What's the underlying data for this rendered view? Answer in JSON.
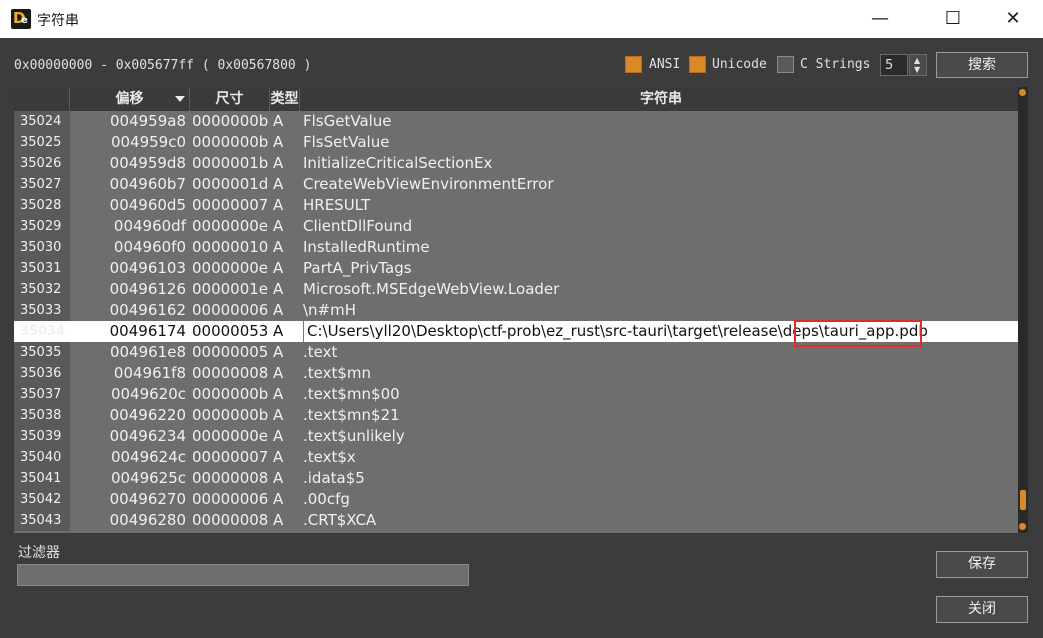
{
  "window": {
    "title": "字符串",
    "minimize": "—",
    "maximize": "☐",
    "close": "✕"
  },
  "range_text": "0x00000000 - 0x005677ff ( 0x00567800 )",
  "options": {
    "ansi": "ANSI",
    "unicode": "Unicode",
    "cstrings": "C Strings",
    "min_length": "5",
    "search_label": "搜索"
  },
  "columns": {
    "index": "",
    "offset": "偏移",
    "size": "尺寸",
    "type": "类型",
    "string": "字符串"
  },
  "rows": [
    {
      "idx": "35024",
      "off": "004959a8",
      "size": "0000000b",
      "type": "A",
      "str": "FlsGetValue"
    },
    {
      "idx": "35025",
      "off": "004959c0",
      "size": "0000000b",
      "type": "A",
      "str": "FlsSetValue"
    },
    {
      "idx": "35026",
      "off": "004959d8",
      "size": "0000001b",
      "type": "A",
      "str": "InitializeCriticalSectionEx"
    },
    {
      "idx": "35027",
      "off": "004960b7",
      "size": "0000001d",
      "type": "A",
      "str": "CreateWebViewEnvironmentError"
    },
    {
      "idx": "35028",
      "off": "004960d5",
      "size": "00000007",
      "type": "A",
      "str": "HRESULT"
    },
    {
      "idx": "35029",
      "off": "004960df",
      "size": "0000000e",
      "type": "A",
      "str": "ClientDllFound"
    },
    {
      "idx": "35030",
      "off": "004960f0",
      "size": "00000010",
      "type": "A",
      "str": "InstalledRuntime"
    },
    {
      "idx": "35031",
      "off": "00496103",
      "size": "0000000e",
      "type": "A",
      "str": "PartA_PrivTags"
    },
    {
      "idx": "35032",
      "off": "00496126",
      "size": "0000001e",
      "type": "A",
      "str": "Microsoft.MSEdgeWebView.Loader"
    },
    {
      "idx": "35033",
      "off": "00496162",
      "size": "00000006",
      "type": "A",
      "str": "\\n#mH"
    },
    {
      "idx": "35034",
      "off": "00496174",
      "size": "00000053",
      "type": "A",
      "str": "C:\\Users\\yll20\\Desktop\\ctf-prob\\ez_rust\\src-tauri\\target\\release\\deps\\tauri_app.pdb",
      "selected": true
    },
    {
      "idx": "35035",
      "off": "004961e8",
      "size": "00000005",
      "type": "A",
      "str": ".text"
    },
    {
      "idx": "35036",
      "off": "004961f8",
      "size": "00000008",
      "type": "A",
      "str": ".text$mn"
    },
    {
      "idx": "35037",
      "off": "0049620c",
      "size": "0000000b",
      "type": "A",
      "str": ".text$mn$00"
    },
    {
      "idx": "35038",
      "off": "00496220",
      "size": "0000000b",
      "type": "A",
      "str": ".text$mn$21"
    },
    {
      "idx": "35039",
      "off": "00496234",
      "size": "0000000e",
      "type": "A",
      "str": ".text$unlikely"
    },
    {
      "idx": "35040",
      "off": "0049624c",
      "size": "00000007",
      "type": "A",
      "str": ".text$x"
    },
    {
      "idx": "35041",
      "off": "0049625c",
      "size": "00000008",
      "type": "A",
      "str": ".idata$5"
    },
    {
      "idx": "35042",
      "off": "00496270",
      "size": "00000006",
      "type": "A",
      "str": ".00cfg"
    },
    {
      "idx": "35043",
      "off": "00496280",
      "size": "00000008",
      "type": "A",
      "str": ".CRT$XCA"
    }
  ],
  "filter": {
    "label": "过滤器",
    "value": ""
  },
  "buttons": {
    "save": "保存",
    "close": "关闭"
  },
  "colors": {
    "accent": "#d9892a",
    "highlight_box": "#e22a2a",
    "background": "#3c3c3c",
    "table_bg": "#6e6e6e"
  }
}
